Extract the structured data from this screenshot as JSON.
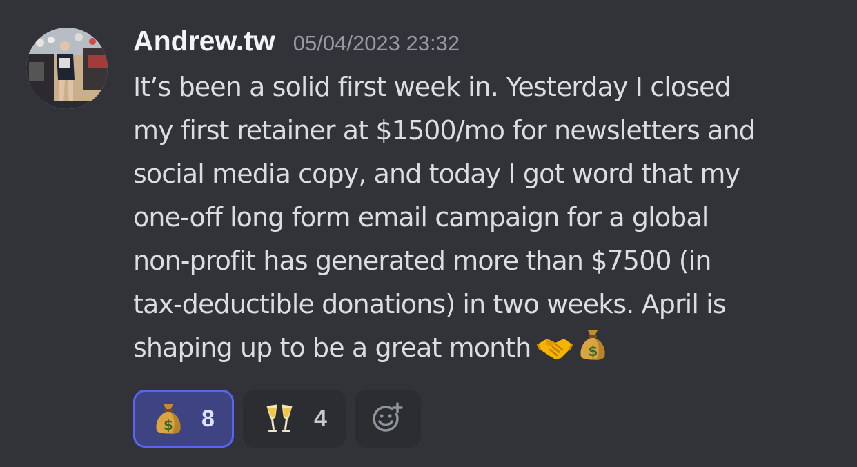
{
  "message": {
    "author": "Andrew.tw",
    "timestamp": "05/04/2023 23:32",
    "content_lines": [
      "It’s been a solid first week in. Yesterday I closed",
      "my first retainer at $1500/mo for newsletters and",
      "social media copy, and today I got word that my",
      "one-off long form email campaign for a global",
      "non-profit has generated more than $7500 (in",
      "tax-deductible donations) in two weeks. April is",
      "shaping up to be a great month"
    ],
    "inline_emojis": [
      "handshake-icon",
      "money-bag-icon"
    ]
  },
  "reactions": [
    {
      "emoji": "money-bag-icon",
      "count": "8",
      "active": true
    },
    {
      "emoji": "clinking-glasses-icon",
      "count": "4",
      "active": false
    }
  ],
  "add_reaction_icon": "add-reaction-icon",
  "colors": {
    "background": "#313338",
    "text": "#dbdee1",
    "username": "#f2f3f5",
    "timestamp": "#949ba4",
    "reaction_bg": "#2b2d31",
    "reaction_active_bg": "#3e4381",
    "reaction_active_border": "#5865f2"
  }
}
